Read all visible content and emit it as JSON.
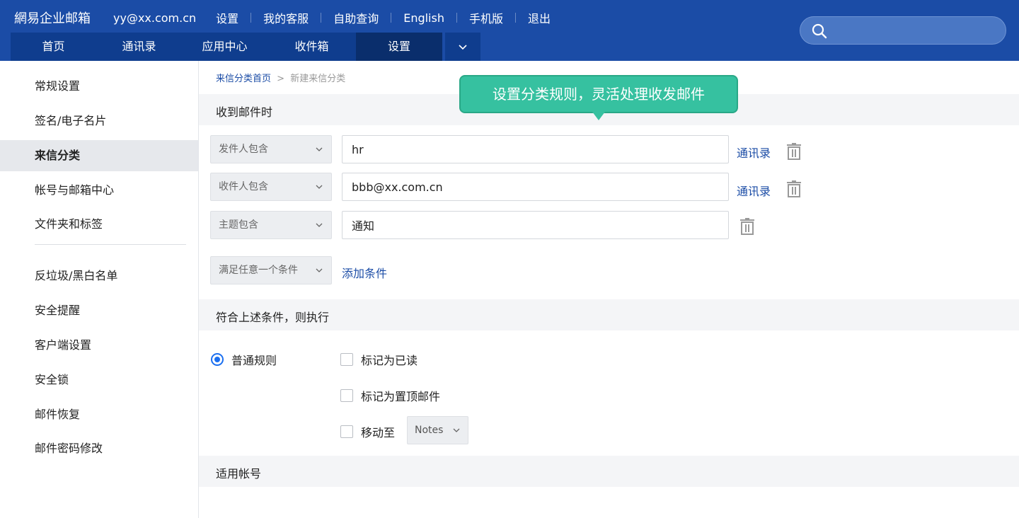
{
  "header": {
    "brand": "網易企业邮箱",
    "account": "yy@xx.com.cn",
    "links": [
      "设置",
      "我的客服",
      "自助查询",
      "English",
      "手机版",
      "退出"
    ],
    "search_placeholder": ""
  },
  "nav": {
    "tabs": [
      "首页",
      "通讯录",
      "应用中心",
      "收件箱",
      "设置"
    ],
    "active_tab": "设置",
    "more_icon": "chevron-down-icon"
  },
  "sidebar": {
    "items": [
      "常规设置",
      "签名/电子名片",
      "来信分类",
      "帐号与邮箱中心",
      "文件夹和标签",
      "反垃圾/黑白名单",
      "安全提醒",
      "客户端设置",
      "安全锁",
      "邮件恢复",
      "邮件密码修改"
    ],
    "active_item": "来信分类"
  },
  "breadcrumb": {
    "link": "来信分类首页",
    "separator": ">",
    "current": "新建来信分类"
  },
  "tooltip": {
    "text": "设置分类规则，灵活处理收发邮件"
  },
  "conditions": {
    "section_title": "收到邮件时",
    "rows": [
      {
        "field": "发件人包含",
        "value": "hr",
        "contact_link": "通讯录"
      },
      {
        "field": "收件人包含",
        "value": "bbb@xx.com.cn",
        "contact_link": "通讯录"
      },
      {
        "field": "主题包含",
        "value": "通知",
        "contact_link": ""
      }
    ],
    "match_mode": "满足任意一个条件",
    "add_label": "添加条件"
  },
  "actions": {
    "section_title": "符合上述条件，则执行",
    "rule_type": "普通规则",
    "options": [
      "标记为已读",
      "标记为置顶邮件",
      "移动至"
    ],
    "move_folder": "Notes"
  },
  "accounts": {
    "section_title": "适用帐号"
  },
  "colors": {
    "header_bg": "#1b4ca6",
    "tab_bg": "#0f3d8e",
    "tab_active_bg": "#0a2e6c",
    "link": "#1b4ca6",
    "tooltip_bg": "#36c1a0",
    "radio": "#1b6ff0"
  }
}
